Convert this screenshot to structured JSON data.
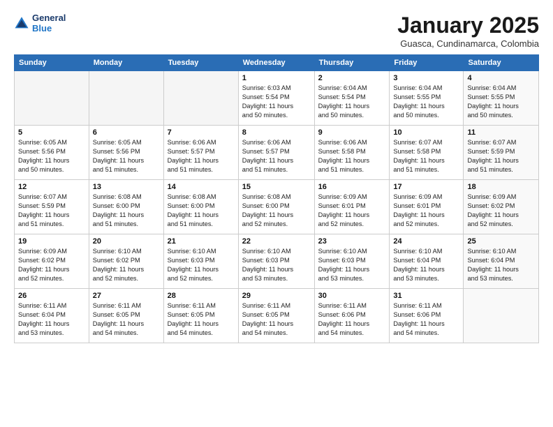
{
  "header": {
    "logo_line1": "General",
    "logo_line2": "Blue",
    "month_title": "January 2025",
    "location": "Guasca, Cundinamarca, Colombia"
  },
  "weekdays": [
    "Sunday",
    "Monday",
    "Tuesday",
    "Wednesday",
    "Thursday",
    "Friday",
    "Saturday"
  ],
  "weeks": [
    [
      {
        "day": "",
        "info": ""
      },
      {
        "day": "",
        "info": ""
      },
      {
        "day": "",
        "info": ""
      },
      {
        "day": "1",
        "info": "Sunrise: 6:03 AM\nSunset: 5:54 PM\nDaylight: 11 hours\nand 50 minutes."
      },
      {
        "day": "2",
        "info": "Sunrise: 6:04 AM\nSunset: 5:54 PM\nDaylight: 11 hours\nand 50 minutes."
      },
      {
        "day": "3",
        "info": "Sunrise: 6:04 AM\nSunset: 5:55 PM\nDaylight: 11 hours\nand 50 minutes."
      },
      {
        "day": "4",
        "info": "Sunrise: 6:04 AM\nSunset: 5:55 PM\nDaylight: 11 hours\nand 50 minutes."
      }
    ],
    [
      {
        "day": "5",
        "info": "Sunrise: 6:05 AM\nSunset: 5:56 PM\nDaylight: 11 hours\nand 50 minutes."
      },
      {
        "day": "6",
        "info": "Sunrise: 6:05 AM\nSunset: 5:56 PM\nDaylight: 11 hours\nand 51 minutes."
      },
      {
        "day": "7",
        "info": "Sunrise: 6:06 AM\nSunset: 5:57 PM\nDaylight: 11 hours\nand 51 minutes."
      },
      {
        "day": "8",
        "info": "Sunrise: 6:06 AM\nSunset: 5:57 PM\nDaylight: 11 hours\nand 51 minutes."
      },
      {
        "day": "9",
        "info": "Sunrise: 6:06 AM\nSunset: 5:58 PM\nDaylight: 11 hours\nand 51 minutes."
      },
      {
        "day": "10",
        "info": "Sunrise: 6:07 AM\nSunset: 5:58 PM\nDaylight: 11 hours\nand 51 minutes."
      },
      {
        "day": "11",
        "info": "Sunrise: 6:07 AM\nSunset: 5:59 PM\nDaylight: 11 hours\nand 51 minutes."
      }
    ],
    [
      {
        "day": "12",
        "info": "Sunrise: 6:07 AM\nSunset: 5:59 PM\nDaylight: 11 hours\nand 51 minutes."
      },
      {
        "day": "13",
        "info": "Sunrise: 6:08 AM\nSunset: 6:00 PM\nDaylight: 11 hours\nand 51 minutes."
      },
      {
        "day": "14",
        "info": "Sunrise: 6:08 AM\nSunset: 6:00 PM\nDaylight: 11 hours\nand 51 minutes."
      },
      {
        "day": "15",
        "info": "Sunrise: 6:08 AM\nSunset: 6:00 PM\nDaylight: 11 hours\nand 52 minutes."
      },
      {
        "day": "16",
        "info": "Sunrise: 6:09 AM\nSunset: 6:01 PM\nDaylight: 11 hours\nand 52 minutes."
      },
      {
        "day": "17",
        "info": "Sunrise: 6:09 AM\nSunset: 6:01 PM\nDaylight: 11 hours\nand 52 minutes."
      },
      {
        "day": "18",
        "info": "Sunrise: 6:09 AM\nSunset: 6:02 PM\nDaylight: 11 hours\nand 52 minutes."
      }
    ],
    [
      {
        "day": "19",
        "info": "Sunrise: 6:09 AM\nSunset: 6:02 PM\nDaylight: 11 hours\nand 52 minutes."
      },
      {
        "day": "20",
        "info": "Sunrise: 6:10 AM\nSunset: 6:02 PM\nDaylight: 11 hours\nand 52 minutes."
      },
      {
        "day": "21",
        "info": "Sunrise: 6:10 AM\nSunset: 6:03 PM\nDaylight: 11 hours\nand 52 minutes."
      },
      {
        "day": "22",
        "info": "Sunrise: 6:10 AM\nSunset: 6:03 PM\nDaylight: 11 hours\nand 53 minutes."
      },
      {
        "day": "23",
        "info": "Sunrise: 6:10 AM\nSunset: 6:03 PM\nDaylight: 11 hours\nand 53 minutes."
      },
      {
        "day": "24",
        "info": "Sunrise: 6:10 AM\nSunset: 6:04 PM\nDaylight: 11 hours\nand 53 minutes."
      },
      {
        "day": "25",
        "info": "Sunrise: 6:10 AM\nSunset: 6:04 PM\nDaylight: 11 hours\nand 53 minutes."
      }
    ],
    [
      {
        "day": "26",
        "info": "Sunrise: 6:11 AM\nSunset: 6:04 PM\nDaylight: 11 hours\nand 53 minutes."
      },
      {
        "day": "27",
        "info": "Sunrise: 6:11 AM\nSunset: 6:05 PM\nDaylight: 11 hours\nand 54 minutes."
      },
      {
        "day": "28",
        "info": "Sunrise: 6:11 AM\nSunset: 6:05 PM\nDaylight: 11 hours\nand 54 minutes."
      },
      {
        "day": "29",
        "info": "Sunrise: 6:11 AM\nSunset: 6:05 PM\nDaylight: 11 hours\nand 54 minutes."
      },
      {
        "day": "30",
        "info": "Sunrise: 6:11 AM\nSunset: 6:06 PM\nDaylight: 11 hours\nand 54 minutes."
      },
      {
        "day": "31",
        "info": "Sunrise: 6:11 AM\nSunset: 6:06 PM\nDaylight: 11 hours\nand 54 minutes."
      },
      {
        "day": "",
        "info": ""
      }
    ]
  ]
}
